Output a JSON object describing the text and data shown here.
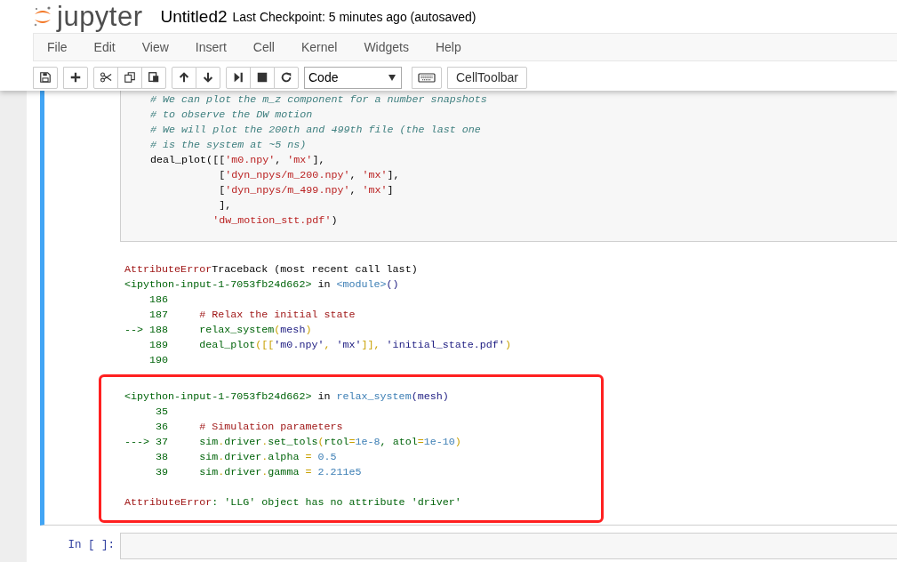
{
  "header": {
    "logo": "jupyter",
    "notebook_name": "Untitled2",
    "checkpoint": "Last Checkpoint: 5 minutes ago (autosaved)"
  },
  "menu": [
    "File",
    "Edit",
    "View",
    "Insert",
    "Cell",
    "Kernel",
    "Widgets",
    "Help"
  ],
  "toolbar": {
    "cell_type": "Code",
    "cell_toolbar": "CellToolbar"
  },
  "cells": [
    {
      "selected": true,
      "code": [
        [
          {
            "kind": "comment",
            "text": "# We can plot the m_z component for a number snapshots"
          }
        ],
        [
          {
            "kind": "comment",
            "text": "# to observe the DW motion"
          }
        ],
        [
          {
            "kind": "comment",
            "text": "# We will plot the 200th and 499th file (the last one"
          }
        ],
        [
          {
            "kind": "comment",
            "text": "# is the system at ~5 ns)"
          }
        ],
        [
          {
            "kind": "plain",
            "text": "deal_plot([["
          },
          {
            "kind": "string",
            "text": "'m0.npy'"
          },
          {
            "kind": "plain",
            "text": ", "
          },
          {
            "kind": "string",
            "text": "'mx'"
          },
          {
            "kind": "plain",
            "text": "],"
          }
        ],
        [
          {
            "kind": "plain",
            "text": "           ["
          },
          {
            "kind": "string",
            "text": "'dyn_npys/m_200.npy'"
          },
          {
            "kind": "plain",
            "text": ", "
          },
          {
            "kind": "string",
            "text": "'mx'"
          },
          {
            "kind": "plain",
            "text": "],"
          }
        ],
        [
          {
            "kind": "plain",
            "text": "           ["
          },
          {
            "kind": "string",
            "text": "'dyn_npys/m_499.npy'"
          },
          {
            "kind": "plain",
            "text": ", "
          },
          {
            "kind": "string",
            "text": "'mx'"
          },
          {
            "kind": "plain",
            "text": "]"
          }
        ],
        [
          {
            "kind": "plain",
            "text": "           ],"
          }
        ],
        [
          {
            "kind": "string",
            "text": "          'dw_motion_stt.pdf'"
          },
          {
            "kind": "plain",
            "text": ")"
          }
        ]
      ],
      "output": [
        {
          "highlighted": false,
          "lines": [
            [
              {
                "kind": "error",
                "text": "AttributeError"
              },
              {
                "kind": "plain",
                "text": "Traceback (most recent call last)"
              }
            ],
            [
              {
                "kind": "green",
                "text": "<ipython-input-1-7053fb24d662>"
              },
              {
                "kind": "plain",
                "text": " in "
              },
              {
                "kind": "cyan",
                "text": "<module>"
              },
              {
                "kind": "navy",
                "text": "()"
              }
            ],
            [
              {
                "kind": "green",
                "text": "    186"
              }
            ],
            [
              {
                "kind": "green",
                "text": "    187     "
              },
              {
                "kind": "error",
                "text": "# Relax the initial state"
              }
            ],
            [
              {
                "kind": "green",
                "text": "--> 188     relax_system"
              },
              {
                "kind": "gold",
                "text": "("
              },
              {
                "kind": "navy",
                "text": "mesh"
              },
              {
                "kind": "gold",
                "text": ")"
              }
            ],
            [
              {
                "kind": "green",
                "text": "    189     deal_plot"
              },
              {
                "kind": "gold",
                "text": "([["
              },
              {
                "kind": "navy",
                "text": "'m0.npy'"
              },
              {
                "kind": "gold",
                "text": ", "
              },
              {
                "kind": "navy",
                "text": "'mx'"
              },
              {
                "kind": "gold",
                "text": "]], "
              },
              {
                "kind": "navy",
                "text": "'initial_state.pdf'"
              },
              {
                "kind": "gold",
                "text": ")"
              }
            ],
            [
              {
                "kind": "green",
                "text": "    190"
              }
            ]
          ]
        },
        {
          "highlighted": true,
          "lines": [
            [
              {
                "kind": "green",
                "text": "<ipython-input-1-7053fb24d662>"
              },
              {
                "kind": "plain",
                "text": " in "
              },
              {
                "kind": "cyan",
                "text": "relax_system"
              },
              {
                "kind": "navy",
                "text": "(mesh)"
              }
            ],
            [
              {
                "kind": "green",
                "text": "     35"
              }
            ],
            [
              {
                "kind": "green",
                "text": "     36     "
              },
              {
                "kind": "error",
                "text": "# Simulation parameters"
              }
            ],
            [
              {
                "kind": "green",
                "text": "---> 37     sim"
              },
              {
                "kind": "gold",
                "text": "."
              },
              {
                "kind": "green",
                "text": "driver"
              },
              {
                "kind": "gold",
                "text": "."
              },
              {
                "kind": "green",
                "text": "set_tols"
              },
              {
                "kind": "gold",
                "text": "("
              },
              {
                "kind": "green",
                "text": "rtol"
              },
              {
                "kind": "gold",
                "text": "="
              },
              {
                "kind": "cyan",
                "text": "1e-8"
              },
              {
                "kind": "green",
                "text": ", atol"
              },
              {
                "kind": "gold",
                "text": "="
              },
              {
                "kind": "cyan",
                "text": "1e-10"
              },
              {
                "kind": "gold",
                "text": ")"
              }
            ],
            [
              {
                "kind": "green",
                "text": "     38     sim"
              },
              {
                "kind": "gold",
                "text": "."
              },
              {
                "kind": "green",
                "text": "driver"
              },
              {
                "kind": "gold",
                "text": "."
              },
              {
                "kind": "green",
                "text": "alpha "
              },
              {
                "kind": "gold",
                "text": "="
              },
              {
                "kind": "cyan",
                "text": " 0.5"
              }
            ],
            [
              {
                "kind": "green",
                "text": "     39     sim"
              },
              {
                "kind": "gold",
                "text": "."
              },
              {
                "kind": "green",
                "text": "driver"
              },
              {
                "kind": "gold",
                "text": "."
              },
              {
                "kind": "green",
                "text": "gamma "
              },
              {
                "kind": "gold",
                "text": "="
              },
              {
                "kind": "cyan",
                "text": " 2.211e5"
              }
            ]
          ],
          "message": [
            {
              "kind": "error",
              "text": "AttributeError"
            },
            {
              "kind": "green",
              "text": ": 'LLG' object has no attribute 'driver'"
            }
          ]
        }
      ]
    },
    {
      "selected": false,
      "prompt": "In [ ]:"
    }
  ]
}
